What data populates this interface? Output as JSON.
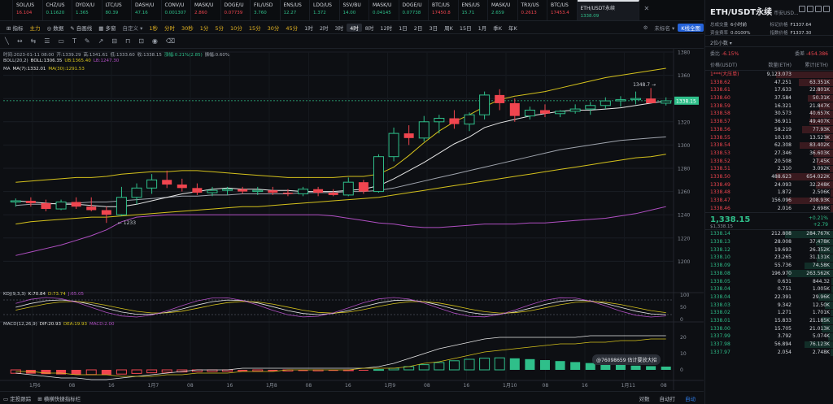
{
  "tickers": [
    {
      "name": "SOL/US",
      "price": "16.104",
      "dir": "dn"
    },
    {
      "name": "CHZ/US",
      "price": "0.11620",
      "dir": "up"
    },
    {
      "name": "DYDX/U",
      "price": "1.365",
      "dir": "up"
    },
    {
      "name": "LTC/US",
      "price": "80.39",
      "dir": "up"
    },
    {
      "name": "DASH/U",
      "price": "47.16",
      "dir": "up"
    },
    {
      "name": "CONV/U",
      "price": "0.001307",
      "dir": "up"
    },
    {
      "name": "MASK/U",
      "price": "2.860",
      "dir": "dn"
    },
    {
      "name": "DOGE/U",
      "price": "0.07739",
      "dir": "dn"
    },
    {
      "name": "FIL/USD",
      "price": "3.760",
      "dir": "up"
    },
    {
      "name": "ENS/US",
      "price": "12.27",
      "dir": "up"
    },
    {
      "name": "LDO/US",
      "price": "1.372",
      "dir": "up"
    },
    {
      "name": "SSV/BU",
      "price": "14.00",
      "dir": "up"
    },
    {
      "name": "MASK/U",
      "price": "0.04145",
      "dir": "up"
    },
    {
      "name": "DOGE/U",
      "price": "0.07738",
      "dir": "up"
    },
    {
      "name": "BTC/US",
      "price": "17450.8",
      "dir": "dn"
    },
    {
      "name": "ENS/US",
      "price": "15.71",
      "dir": "up"
    },
    {
      "name": "MASK/U",
      "price": "2.659",
      "dir": "up"
    },
    {
      "name": "TRX/US",
      "price": "0.2613",
      "dir": "dn"
    },
    {
      "name": "BTC/US",
      "price": "17453.4",
      "dir": "dn"
    }
  ],
  "active_ticker": {
    "name": "ETH/USDT永续",
    "price": "1338.09"
  },
  "toolbar": {
    "indicators": "指标",
    "main": "主力",
    "vol_label": "数据",
    "auto": "自画线",
    "more": "多窗",
    "custom": "自定义",
    "intervals": [
      "1秒",
      "分时",
      "30秒",
      "1分",
      "5分",
      "10分",
      "15分",
      "30分",
      "45分",
      "1时",
      "2时",
      "3时",
      "4时",
      "8时",
      "12时",
      "1日",
      "2日",
      "3日",
      "周K",
      "15日",
      "1月",
      "季K",
      "年K"
    ],
    "selected_interval": "4时",
    "mode": "K线全图",
    "timestamp_toggle": "未标名"
  },
  "info": {
    "line1": [
      "时间:2023-01-11 08:00",
      "开:1339.29",
      "高:1341.61",
      "低:1333.60",
      "收:1338.15",
      "涨幅:0.21%(2.85)",
      "振幅:0.60%"
    ],
    "boll": [
      "BOLL(20,2)",
      "BOLL:1306.35",
      "UB:1365.40",
      "LB:1247.30"
    ],
    "ma": [
      "MA",
      "MA(7):1332.01",
      "MA(30):1291.53"
    ],
    "kdj": [
      "KDJ(9,3,3)",
      "K:70.84",
      "D:73.74",
      "J:65.05"
    ],
    "macd": [
      "MACD(12,26,9)",
      "DIF:20.93",
      "DEA:19.93",
      "MACD:2.00"
    ]
  },
  "chart_data": {
    "type": "candlestick",
    "title": "ETH/USDT永续",
    "interval": "4时",
    "ylim": [
      1180,
      1380
    ],
    "yticks": [
      1380,
      1360,
      1340,
      1320,
      1300,
      1280,
      1260,
      1240,
      1220,
      1200
    ],
    "xticks": [
      "1月6",
      "08",
      "16",
      "1月7",
      "08",
      "16",
      "1月8",
      "08",
      "16",
      "1月9",
      "08",
      "16",
      "1月10",
      "08",
      "16",
      "1月11",
      "08"
    ],
    "current_price": "1338.15",
    "annotations": {
      "high": "1348.7",
      "low": "1233"
    },
    "candles": [
      {
        "o": 1251,
        "h": 1254,
        "l": 1247,
        "c": 1252
      },
      {
        "o": 1252,
        "h": 1255,
        "l": 1247,
        "c": 1250
      },
      {
        "o": 1250,
        "h": 1253,
        "l": 1243,
        "c": 1245
      },
      {
        "o": 1245,
        "h": 1253,
        "l": 1244,
        "c": 1251
      },
      {
        "o": 1251,
        "h": 1255,
        "l": 1245,
        "c": 1247
      },
      {
        "o": 1247,
        "h": 1255,
        "l": 1243,
        "c": 1244
      },
      {
        "o": 1244,
        "h": 1247,
        "l": 1233,
        "c": 1240
      },
      {
        "o": 1240,
        "h": 1264,
        "l": 1239,
        "c": 1255
      },
      {
        "o": 1255,
        "h": 1267,
        "l": 1249,
        "c": 1263
      },
      {
        "o": 1263,
        "h": 1275,
        "l": 1258,
        "c": 1270
      },
      {
        "o": 1270,
        "h": 1278,
        "l": 1263,
        "c": 1266
      },
      {
        "o": 1266,
        "h": 1271,
        "l": 1260,
        "c": 1263
      },
      {
        "o": 1263,
        "h": 1267,
        "l": 1257,
        "c": 1259
      },
      {
        "o": 1259,
        "h": 1264,
        "l": 1256,
        "c": 1261
      },
      {
        "o": 1261,
        "h": 1264,
        "l": 1257,
        "c": 1262
      },
      {
        "o": 1262,
        "h": 1264,
        "l": 1258,
        "c": 1260
      },
      {
        "o": 1260,
        "h": 1264,
        "l": 1257,
        "c": 1261
      },
      {
        "o": 1261,
        "h": 1264,
        "l": 1257,
        "c": 1259
      },
      {
        "o": 1259,
        "h": 1262,
        "l": 1256,
        "c": 1258
      },
      {
        "o": 1258,
        "h": 1264,
        "l": 1256,
        "c": 1262
      },
      {
        "o": 1262,
        "h": 1264,
        "l": 1256,
        "c": 1259
      },
      {
        "o": 1259,
        "h": 1262,
        "l": 1256,
        "c": 1257
      },
      {
        "o": 1257,
        "h": 1272,
        "l": 1256,
        "c": 1268
      },
      {
        "o": 1268,
        "h": 1270,
        "l": 1258,
        "c": 1260
      },
      {
        "o": 1260,
        "h": 1292,
        "l": 1259,
        "c": 1290
      },
      {
        "o": 1290,
        "h": 1315,
        "l": 1286,
        "c": 1310
      },
      {
        "o": 1310,
        "h": 1317,
        "l": 1300,
        "c": 1306
      },
      {
        "o": 1306,
        "h": 1325,
        "l": 1303,
        "c": 1320
      },
      {
        "o": 1320,
        "h": 1326,
        "l": 1310,
        "c": 1323
      },
      {
        "o": 1323,
        "h": 1330,
        "l": 1314,
        "c": 1318
      },
      {
        "o": 1318,
        "h": 1328,
        "l": 1312,
        "c": 1326
      },
      {
        "o": 1326,
        "h": 1346,
        "l": 1322,
        "c": 1343
      },
      {
        "o": 1343,
        "h": 1348,
        "l": 1330,
        "c": 1336
      },
      {
        "o": 1336,
        "h": 1340,
        "l": 1320,
        "c": 1325
      },
      {
        "o": 1325,
        "h": 1333,
        "l": 1322,
        "c": 1330
      },
      {
        "o": 1330,
        "h": 1335,
        "l": 1324,
        "c": 1327
      },
      {
        "o": 1327,
        "h": 1330,
        "l": 1324,
        "c": 1329
      },
      {
        "o": 1329,
        "h": 1335,
        "l": 1327,
        "c": 1331
      },
      {
        "o": 1331,
        "h": 1337,
        "l": 1326,
        "c": 1334
      },
      {
        "o": 1334,
        "h": 1341,
        "l": 1331,
        "c": 1338
      },
      {
        "o": 1338,
        "h": 1342,
        "l": 1333,
        "c": 1339
      },
      {
        "o": 1339,
        "h": 1346,
        "l": 1335,
        "c": 1340
      },
      {
        "o": 1340,
        "h": 1349,
        "l": 1336,
        "c": 1336
      },
      {
        "o": 1336,
        "h": 1341,
        "l": 1334,
        "c": 1338
      }
    ],
    "ma7": [
      1252,
      1251,
      1250,
      1249,
      1249,
      1248,
      1247,
      1247,
      1249,
      1252,
      1255,
      1258,
      1260,
      1262,
      1263,
      1262,
      1262,
      1261,
      1261,
      1260,
      1260,
      1260,
      1261,
      1262,
      1265,
      1271,
      1278,
      1285,
      1293,
      1301,
      1307,
      1315,
      1319,
      1322,
      1325,
      1327,
      1329,
      1330,
      1330,
      1331,
      1332,
      1334,
      1336,
      1338
    ],
    "ma30": [
      1232,
      1234,
      1235,
      1236,
      1237,
      1238,
      1238,
      1239,
      1240,
      1241,
      1242,
      1243,
      1244,
      1245,
      1246,
      1247,
      1247,
      1248,
      1249,
      1250,
      1251,
      1252,
      1253,
      1254,
      1255,
      1257,
      1259,
      1261,
      1263,
      1265,
      1267,
      1269,
      1271,
      1273,
      1275,
      1277,
      1279,
      1281,
      1283,
      1285,
      1287,
      1289,
      1290,
      1292
    ],
    "boll_mid": [
      1248,
      1249,
      1249,
      1250,
      1250,
      1251,
      1251,
      1252,
      1253,
      1254,
      1255,
      1256,
      1256,
      1257,
      1257,
      1258,
      1258,
      1258,
      1258,
      1259,
      1259,
      1259,
      1260,
      1260,
      1261,
      1263,
      1266,
      1269,
      1272,
      1275,
      1278,
      1281,
      1284,
      1287,
      1290,
      1293,
      1296,
      1298,
      1300,
      1302,
      1304,
      1305,
      1306,
      1307
    ],
    "boll_ub": [
      1268,
      1269,
      1270,
      1271,
      1272,
      1272,
      1273,
      1275,
      1276,
      1277,
      1277,
      1278,
      1278,
      1277,
      1276,
      1275,
      1274,
      1273,
      1272,
      1272,
      1272,
      1272,
      1273,
      1273,
      1275,
      1281,
      1291,
      1302,
      1312,
      1320,
      1326,
      1333,
      1339,
      1342,
      1344,
      1346,
      1349,
      1352,
      1355,
      1358,
      1360,
      1362,
      1364,
      1366
    ],
    "boll_lb": [
      1205,
      1208,
      1211,
      1214,
      1218,
      1222,
      1227,
      1234,
      1238,
      1239,
      1240,
      1240,
      1240,
      1240,
      1240,
      1240,
      1240,
      1240,
      1240,
      1240,
      1240,
      1239,
      1237,
      1235,
      1233,
      1232,
      1230,
      1229,
      1229,
      1230,
      1231,
      1232,
      1232,
      1232,
      1233,
      1233,
      1234,
      1235,
      1236,
      1237,
      1239,
      1241,
      1244,
      1247
    ],
    "kdj": {
      "yticks": [
        100,
        50,
        0
      ],
      "k": 70.84,
      "d": 73.74,
      "j": 65.05
    },
    "macd": {
      "yticks": [
        20,
        10,
        0
      ],
      "dif": 20.93,
      "dea": 19.93,
      "macd": 2.0,
      "hist": [
        -2.1,
        -2.3,
        -2.6,
        -2.8,
        -3.0,
        -2.9,
        -3.1,
        -2.6,
        -2.2,
        -1.8,
        -1.5,
        -1.3,
        -1.1,
        -1.0,
        -0.9,
        -0.9,
        -0.8,
        -0.8,
        -0.7,
        -0.7,
        -0.6,
        -0.6,
        -0.5,
        -0.5,
        0.2,
        1.0,
        2.0,
        3.2,
        4.5,
        5.6,
        6.5,
        7.2,
        7.4,
        7.1,
        6.6,
        6.0,
        5.4,
        4.8,
        4.2,
        3.6,
        3.0,
        2.6,
        2.3,
        2.0
      ],
      "dif_line": [
        -2,
        -3,
        -4,
        -5,
        -5,
        -6,
        -6,
        -5,
        -4,
        -3,
        -2,
        -1,
        0,
        0,
        0,
        1,
        1,
        1,
        1,
        1,
        1,
        1,
        1,
        1,
        2,
        4,
        7,
        10,
        13,
        15,
        17,
        19,
        20,
        20,
        20,
        20,
        20,
        20,
        21,
        21,
        21,
        21,
        21,
        21
      ],
      "dea_line": [
        -1,
        -1,
        -2,
        -2,
        -3,
        -3,
        -3,
        -4,
        -4,
        -4,
        -3,
        -3,
        -2,
        -2,
        -2,
        -1,
        -1,
        -1,
        0,
        0,
        0,
        0,
        0,
        1,
        1,
        1,
        2,
        4,
        5,
        7,
        9,
        11,
        12,
        13,
        14,
        15,
        16,
        16,
        17,
        17,
        18,
        18,
        19,
        19
      ]
    }
  },
  "tooltip": "@76098659 估计要放大招",
  "bottom": {
    "left1": "定投跟踪",
    "left2": "横横快捷指标栏",
    "right": [
      "对数",
      "自动打",
      "自动"
    ]
  },
  "book": {
    "title": "ETH/USDT永续",
    "exchange": "币安USD...",
    "sub": [
      {
        "k": "总成交量",
        "v": "6小时前"
      },
      {
        "k": "标记价格",
        "v": "F1337.64"
      },
      {
        "k": "资金费率",
        "v": "0.0100%"
      },
      {
        "k": "指数价格",
        "v": "F1337.30"
      }
    ],
    "step": "2位小数",
    "ratio_label": "委比",
    "ratio_pct": "-6.15%",
    "ratio_diff": "委差",
    "ratio_val": "-454.386",
    "columns": [
      "价格(USDT)",
      "数量(ETH)",
      "累计(ETH)"
    ],
    "asks": [
      {
        "p": "1***(大压单)",
        "a": "9,123.073",
        "t": "",
        "w": 1.0
      },
      {
        "p": "1338.62",
        "a": "47.251",
        "t": "63.351K",
        "w": 0.6
      },
      {
        "p": "1338.61",
        "a": "17.633",
        "t": "22.801K",
        "w": 0.3
      },
      {
        "p": "1338.60",
        "a": "37.584",
        "t": "50.31K",
        "w": 0.45
      },
      {
        "p": "1338.59",
        "a": "16.321",
        "t": "21.847K",
        "w": 0.25
      },
      {
        "p": "1338.58",
        "a": "30.573",
        "t": "40.657K",
        "w": 0.4
      },
      {
        "p": "1338.57",
        "a": "36.911",
        "t": "49.407K",
        "w": 0.42
      },
      {
        "p": "1338.56",
        "a": "58.219",
        "t": "77.93K",
        "w": 0.55
      },
      {
        "p": "1338.55",
        "a": "10.103",
        "t": "13.523K",
        "w": 0.15
      },
      {
        "p": "1338.54",
        "a": "62.308",
        "t": "83.402K",
        "w": 0.58
      },
      {
        "p": "1338.53",
        "a": "27.346",
        "t": "36.603K",
        "w": 0.34
      },
      {
        "p": "1338.52",
        "a": "20.508",
        "t": "27.45K",
        "w": 0.28
      },
      {
        "p": "1338.51",
        "a": "2.310",
        "t": "3.092K",
        "w": 0.06
      },
      {
        "p": "1338.50",
        "a": "488.623",
        "t": "654.022K",
        "w": 1.0
      },
      {
        "p": "1338.49",
        "a": "24.093",
        "t": "32.248K",
        "w": 0.3
      },
      {
        "p": "1338.48",
        "a": "1.872",
        "t": "2.506K",
        "w": 0.05
      },
      {
        "p": "1338.47",
        "a": "156.096",
        "t": "208.93K",
        "w": 0.8
      },
      {
        "p": "1338.46",
        "a": "2.016",
        "t": "2.698K",
        "w": 0.05
      }
    ],
    "last": {
      "price": "1,338.15",
      "usd": "$1,338.15",
      "pct": "+0.21%",
      "diff": "+2.79"
    },
    "bids": [
      {
        "p": "1338.14",
        "a": "212.808",
        "t": "284.767K",
        "w": 0.85
      },
      {
        "p": "1338.13",
        "a": "28.008",
        "t": "37.478K",
        "w": 0.3
      },
      {
        "p": "1338.12",
        "a": "19.693",
        "t": "26.352K",
        "w": 0.25
      },
      {
        "p": "1338.10",
        "a": "23.265",
        "t": "31.131K",
        "w": 0.28
      },
      {
        "p": "1338.09",
        "a": "55.736",
        "t": "74.58K",
        "w": 0.5
      },
      {
        "p": "1338.08",
        "a": "196.970",
        "t": "263.562K",
        "w": 0.8
      },
      {
        "p": "1338.05",
        "a": "0.631",
        "t": "844.32",
        "w": 0.03
      },
      {
        "p": "1338.04",
        "a": "0.751",
        "t": "1.005K",
        "w": 0.03
      },
      {
        "p": "1338.04",
        "a": "22.391",
        "t": "29.96K",
        "w": 0.26
      },
      {
        "p": "1338.03",
        "a": "9.342",
        "t": "12.50K",
        "w": 0.14
      },
      {
        "p": "1338.02",
        "a": "1.271",
        "t": "1.701K",
        "w": 0.05
      },
      {
        "p": "1338.01",
        "a": "15.833",
        "t": "21.185K",
        "w": 0.2
      },
      {
        "p": "1338.00",
        "a": "15.705",
        "t": "21.013K",
        "w": 0.2
      },
      {
        "p": "1337.99",
        "a": "3.792",
        "t": "5.074K",
        "w": 0.08
      },
      {
        "p": "1337.98",
        "a": "56.894",
        "t": "76.123K",
        "w": 0.5
      },
      {
        "p": "1337.97",
        "a": "2.054",
        "t": "2.748K",
        "w": 0.05
      }
    ]
  },
  "colors": {
    "up": "#2fbf8a",
    "down": "#f0454f",
    "ma7": "#e6e6e6",
    "ma30": "#d4c11c",
    "boll_band": "#d4c11c",
    "boll_lb": "#b04fc2"
  }
}
